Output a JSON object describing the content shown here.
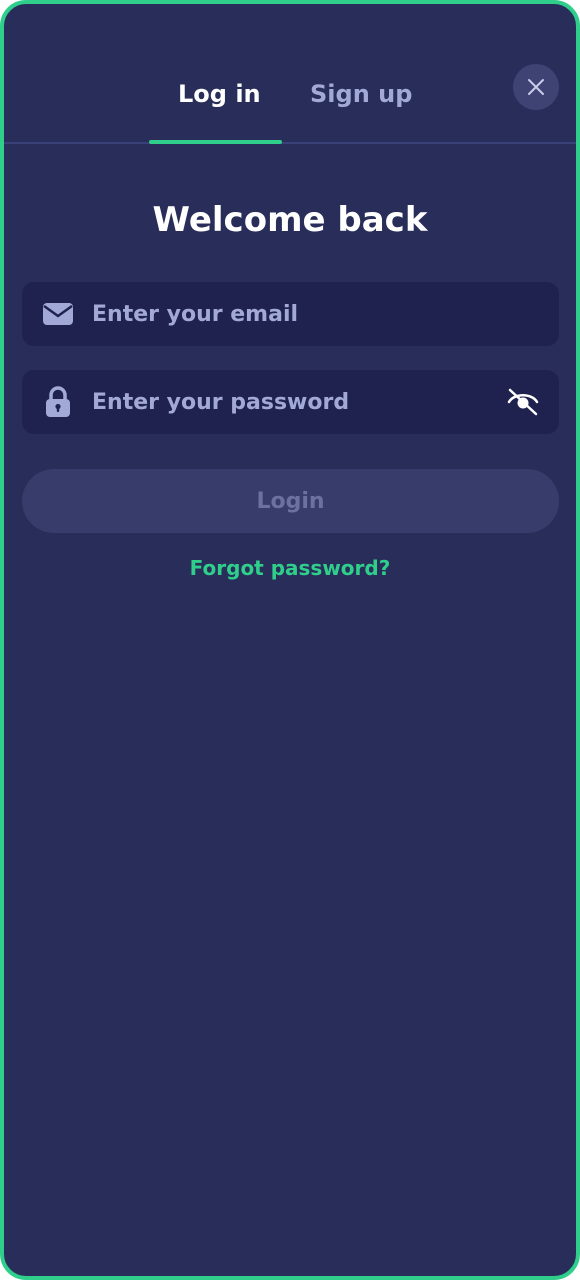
{
  "tabs": {
    "login_label": "Log in",
    "signup_label": "Sign up",
    "active": "login"
  },
  "title": "Welcome back",
  "email": {
    "placeholder": "Enter your email",
    "value": "",
    "icon": "envelope-icon"
  },
  "password": {
    "placeholder": "Enter your password",
    "value": "",
    "icon": "lock-icon",
    "toggle_icon": "eye-off-icon"
  },
  "login_button": {
    "label": "Login",
    "disabled": true
  },
  "forgot_link": "Forgot password?",
  "colors": {
    "accent": "#2fcf8b",
    "background": "#282d5a",
    "field": "#1f224f",
    "muted_text": "#a3a9d6"
  }
}
